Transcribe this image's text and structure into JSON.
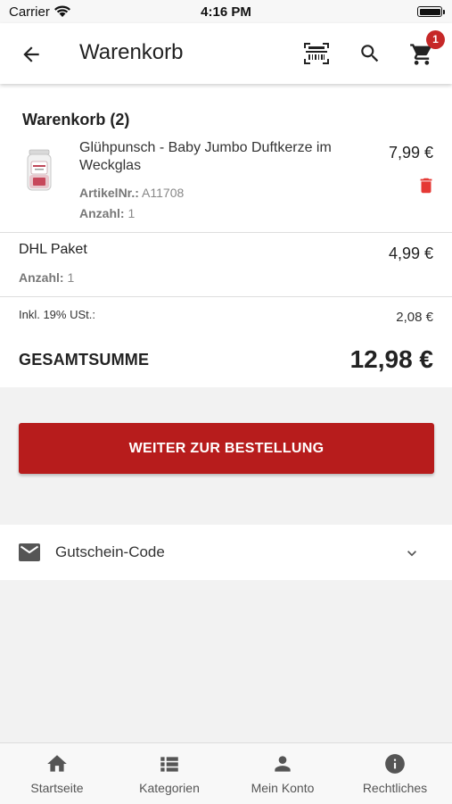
{
  "status_bar": {
    "carrier": "Carrier",
    "time": "4:16 PM"
  },
  "header": {
    "title": "Warenkorb",
    "cart_badge": "1",
    "icons": [
      "back-arrow-icon",
      "barcode-scan-icon",
      "search-icon",
      "cart-icon"
    ]
  },
  "cart": {
    "heading": "Warenkorb (2)",
    "item": {
      "name": "Glühpunsch - Baby Jumbo Duftkerze im Weckglas",
      "price": "7,99 €",
      "article_label": "ArtikelNr.:",
      "article_value": "A11708",
      "qty_label": "Anzahl:",
      "qty_value": "1"
    },
    "shipping": {
      "name": "DHL Paket",
      "price": "4,99 €",
      "qty_label": "Anzahl:",
      "qty_value": "1"
    },
    "tax": {
      "label": "Inkl. 19% USt.:",
      "value": "2,08 €"
    },
    "total": {
      "label": "GESAMTSUMME",
      "value": "12,98 €"
    }
  },
  "checkout_button": "WEITER ZUR BESTELLUNG",
  "voucher": {
    "label": "Gutschein-Code",
    "icon": "mail-icon"
  },
  "tabs": [
    {
      "label": "Startseite",
      "icon": "home-icon"
    },
    {
      "label": "Kategorien",
      "icon": "list-icon"
    },
    {
      "label": "Mein Konto",
      "icon": "person-icon"
    },
    {
      "label": "Rechtliches",
      "icon": "info-icon"
    }
  ],
  "colors": {
    "accent": "#b71c1c",
    "badge": "#c62828",
    "delete": "#e53935"
  }
}
